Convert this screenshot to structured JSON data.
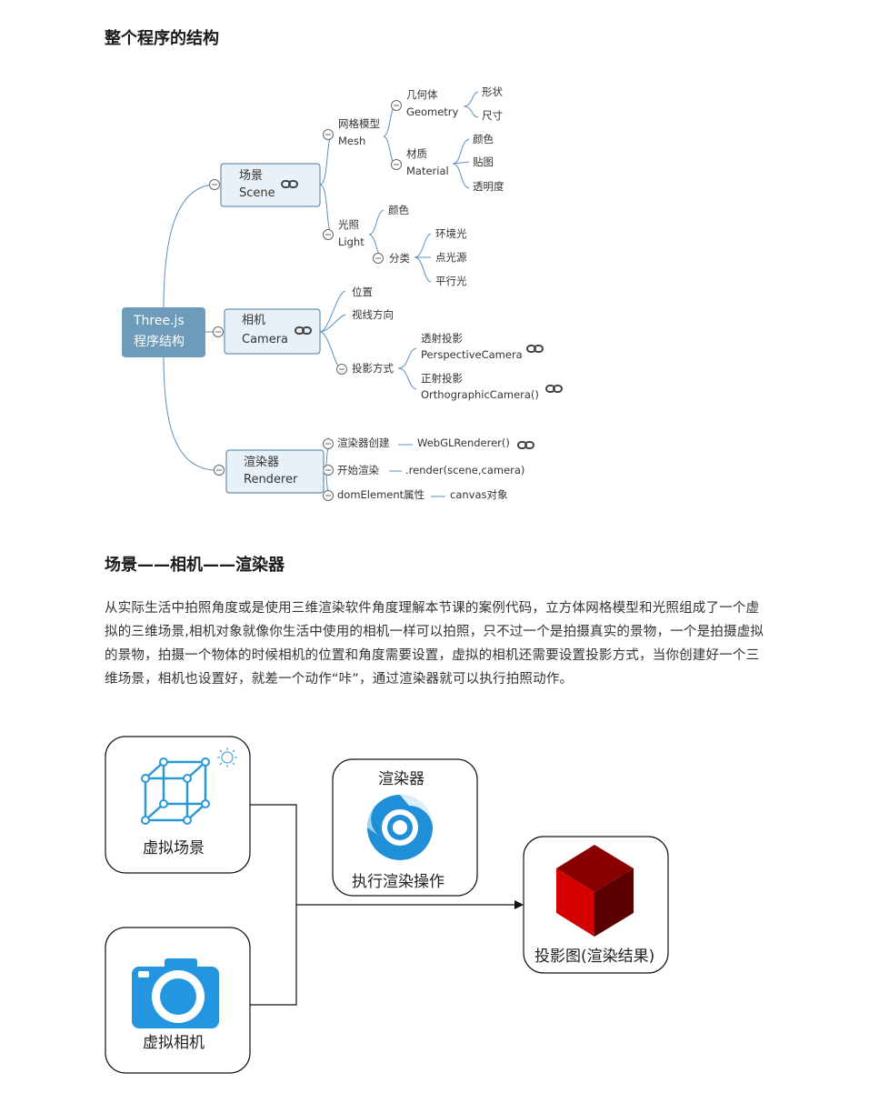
{
  "sections": {
    "structure_title": "整个程序的结构",
    "scr_title": "场景——相机——渲染器"
  },
  "paragraph": "从实际生活中拍照角度或是使用三维渲染软件角度理解本节课的案例代码，立方体网格模型和光照组成了一个虚拟的三维场景,相机对象就像你生活中使用的相机一样可以拍照，只不过一个是拍摄真实的景物，一个是拍摄虚拟的景物，拍摄一个物体的时候相机的位置和角度需要设置，虚拟的相机还需要设置投影方式，当你创建好一个三维场景，相机也设置好，就差一个动作“咔”，通过渲染器就可以执行拍照动作。",
  "mindmap": {
    "root": [
      "Three.js",
      "程序结构"
    ],
    "scene": [
      "场景",
      "Scene"
    ],
    "mesh": [
      "网格模型",
      "Mesh"
    ],
    "geometry": [
      "几何体",
      "Geometry"
    ],
    "shape": "形状",
    "size": "尺寸",
    "material": [
      "材质",
      "Material"
    ],
    "mat_color": "颜色",
    "texture": "贴图",
    "opacity": "透明度",
    "light": [
      "光照",
      "Light"
    ],
    "light_color": "颜色",
    "category": "分类",
    "ambient": "环境光",
    "point": "点光源",
    "directional": "平行光",
    "camera": [
      "相机",
      "Camera"
    ],
    "position": "位置",
    "view_dir": "视线方向",
    "projection": "投影方式",
    "perspective": [
      "透射投影",
      "PerspectiveCamera"
    ],
    "ortho": [
      "正射投影",
      "OrthographicCamera()"
    ],
    "renderer": [
      "渲染器",
      "Renderer"
    ],
    "create": "渲染器创建",
    "create_val": "WebGLRenderer()",
    "start": "开始渲染",
    "start_val": ".render(scene,camera)",
    "dom": "domElement属性",
    "dom_val": "canvas对象"
  },
  "flow": {
    "virtual_scene": "虚拟场景",
    "virtual_camera": "虚拟相机",
    "renderer_title": "渲染器",
    "renderer_action": "执行渲染操作",
    "result": "投影图(渲染结果)"
  },
  "colors": {
    "root_fill": "#6f9bbb",
    "node_fill": "#e8f1f8",
    "node_stroke": "#4a7aa0",
    "branch_line": "#5b8fbf",
    "cube_icon": "#2a97d6",
    "camera_icon": "#2496e0",
    "renderer_icon": "#1f8fd8",
    "result_cube": "#b40000"
  }
}
